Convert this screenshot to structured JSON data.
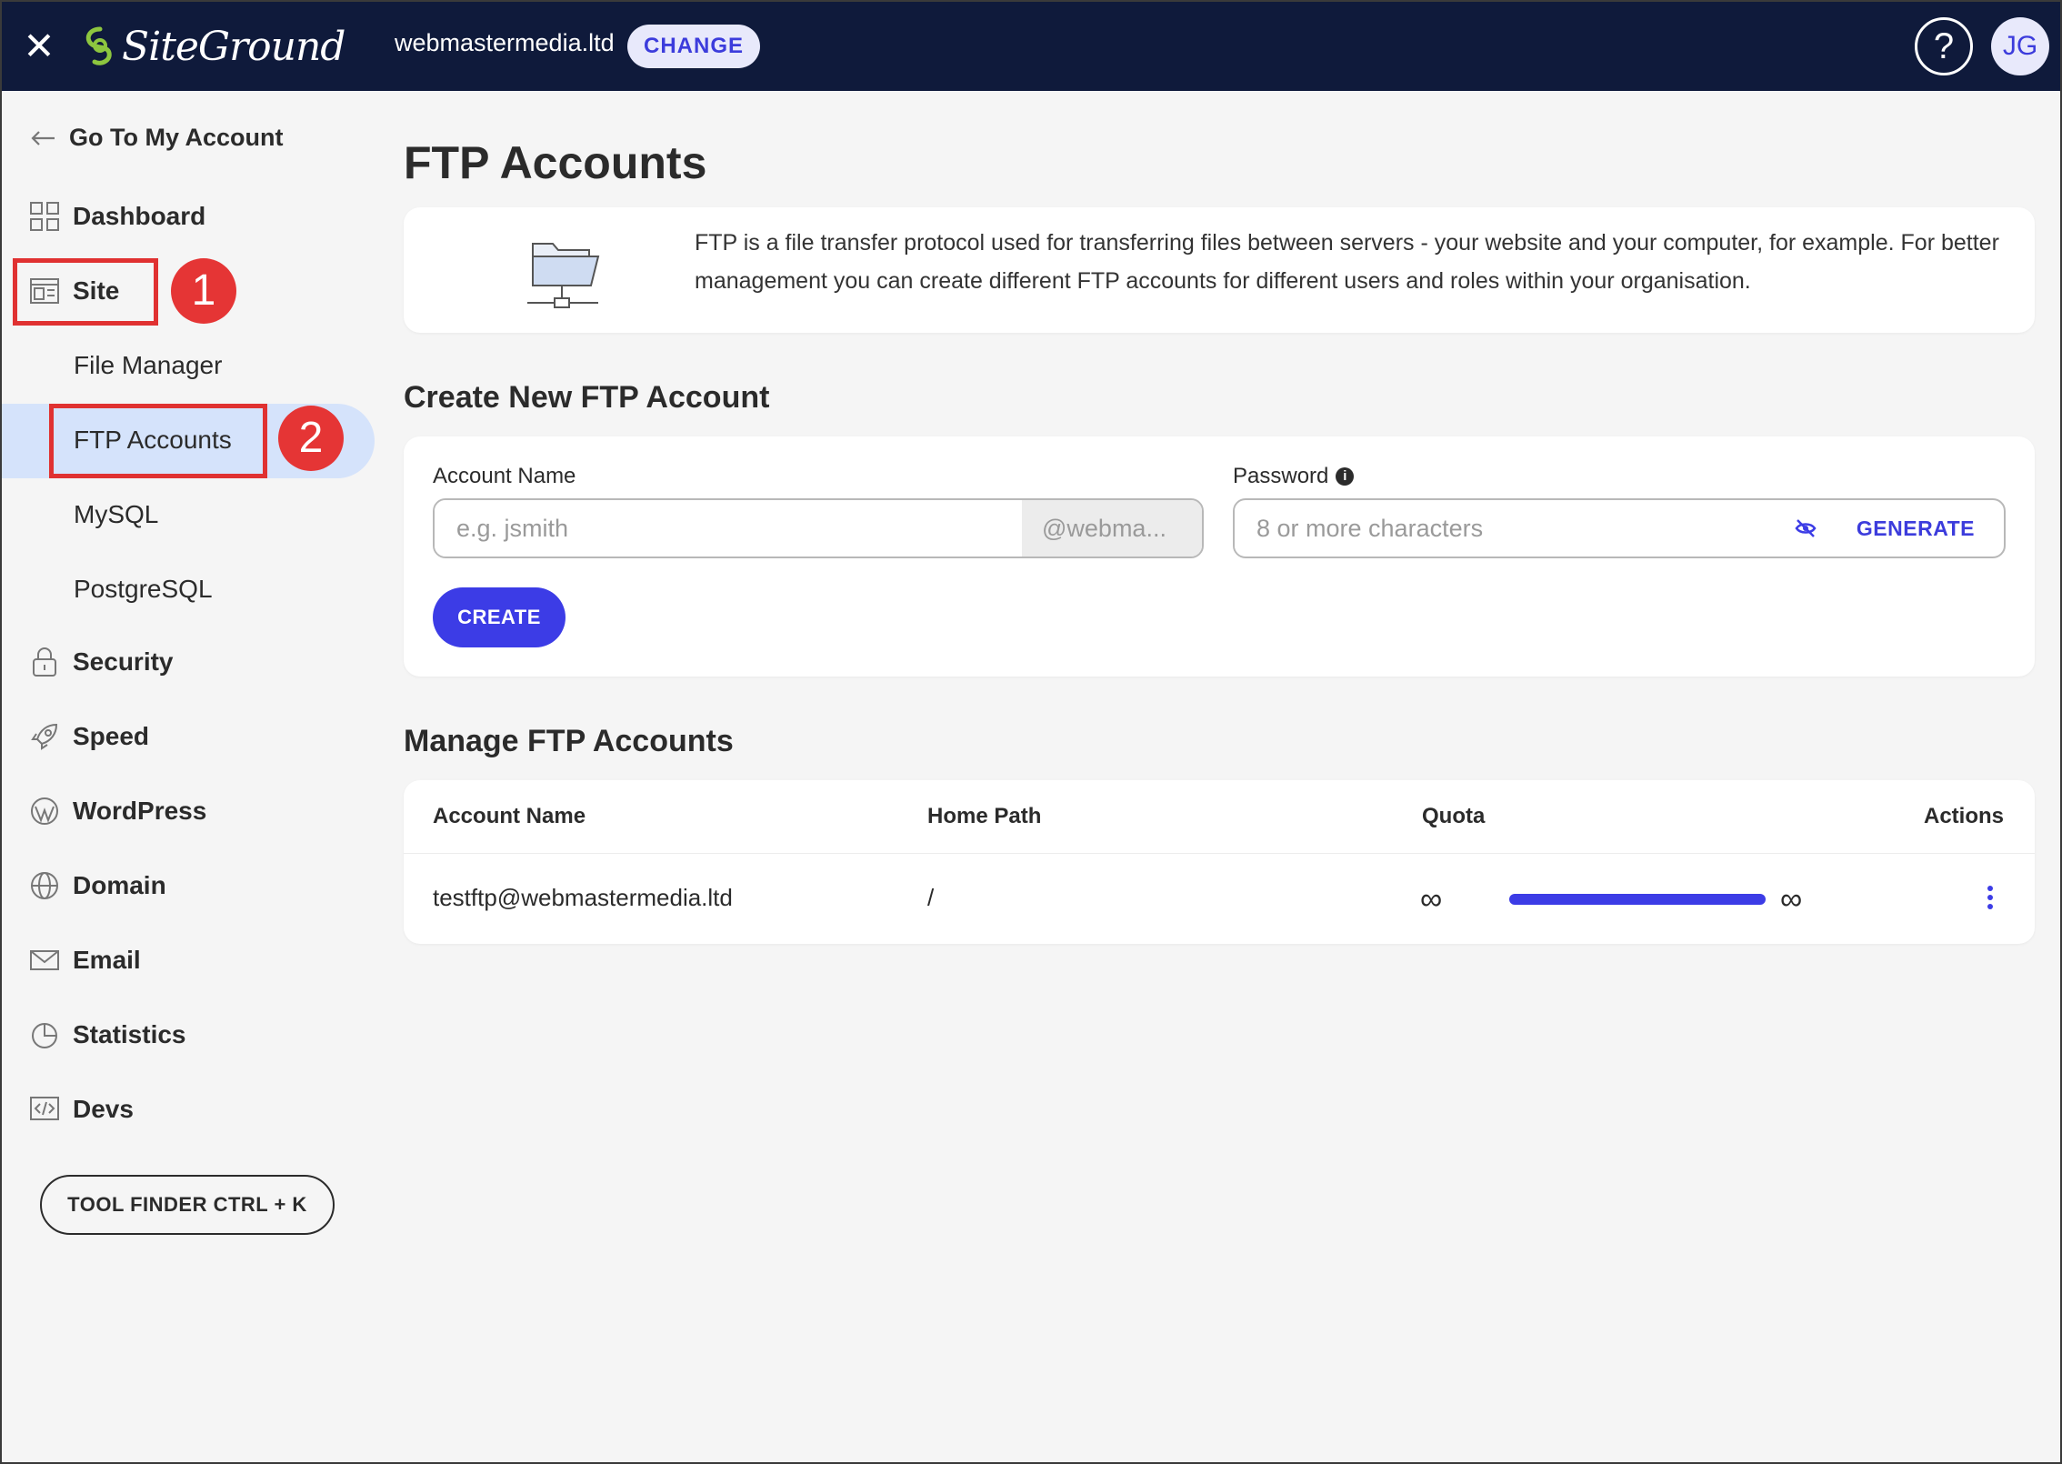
{
  "topbar": {
    "brand": "SiteGround",
    "domain": "webmastermedia.ltd",
    "change_label": "CHANGE",
    "help_label": "?",
    "user_initials": "JG"
  },
  "sidebar": {
    "back_label": "Go To My Account",
    "items": [
      {
        "label": "Dashboard",
        "icon": "grid-icon"
      },
      {
        "label": "Site",
        "icon": "site-icon"
      },
      {
        "label": "Security",
        "icon": "lock-icon"
      },
      {
        "label": "Speed",
        "icon": "rocket-icon"
      },
      {
        "label": "WordPress",
        "icon": "wordpress-icon"
      },
      {
        "label": "Domain",
        "icon": "globe-icon"
      },
      {
        "label": "Email",
        "icon": "envelope-icon"
      },
      {
        "label": "Statistics",
        "icon": "pie-chart-icon"
      },
      {
        "label": "Devs",
        "icon": "code-icon"
      }
    ],
    "site_subitems": [
      "File Manager",
      "FTP Accounts",
      "MySQL",
      "PostgreSQL"
    ],
    "active_subitem": "FTP Accounts",
    "tool_finder_label": "TOOL FINDER CTRL + K",
    "annotations": [
      "1",
      "2"
    ]
  },
  "main": {
    "title": "FTP Accounts",
    "info_text": "FTP is a file transfer protocol used for transferring files between servers - your website and your computer, for example. For better management you can create different FTP accounts for different users and roles within your organisation.",
    "create_section": {
      "title": "Create New FTP Account",
      "account_label": "Account Name",
      "account_placeholder": "e.g. jsmith",
      "account_suffix": "@webma...",
      "password_label": "Password",
      "password_placeholder": "8 or more characters",
      "generate_label": "GENERATE",
      "create_label": "CREATE"
    },
    "manage_section": {
      "title": "Manage FTP Accounts",
      "columns": [
        "Account Name",
        "Home Path",
        "Quota",
        "Actions"
      ],
      "rows": [
        {
          "account": "testftp@webmastermedia.ltd",
          "home_path": "/",
          "quota_used": "∞",
          "quota_total": "∞"
        }
      ]
    }
  },
  "colors": {
    "topbar_bg": "#0f1a3b",
    "accent": "#3c3ce6",
    "annotation_red": "#e03131",
    "active_bg": "#d5e3fb"
  }
}
